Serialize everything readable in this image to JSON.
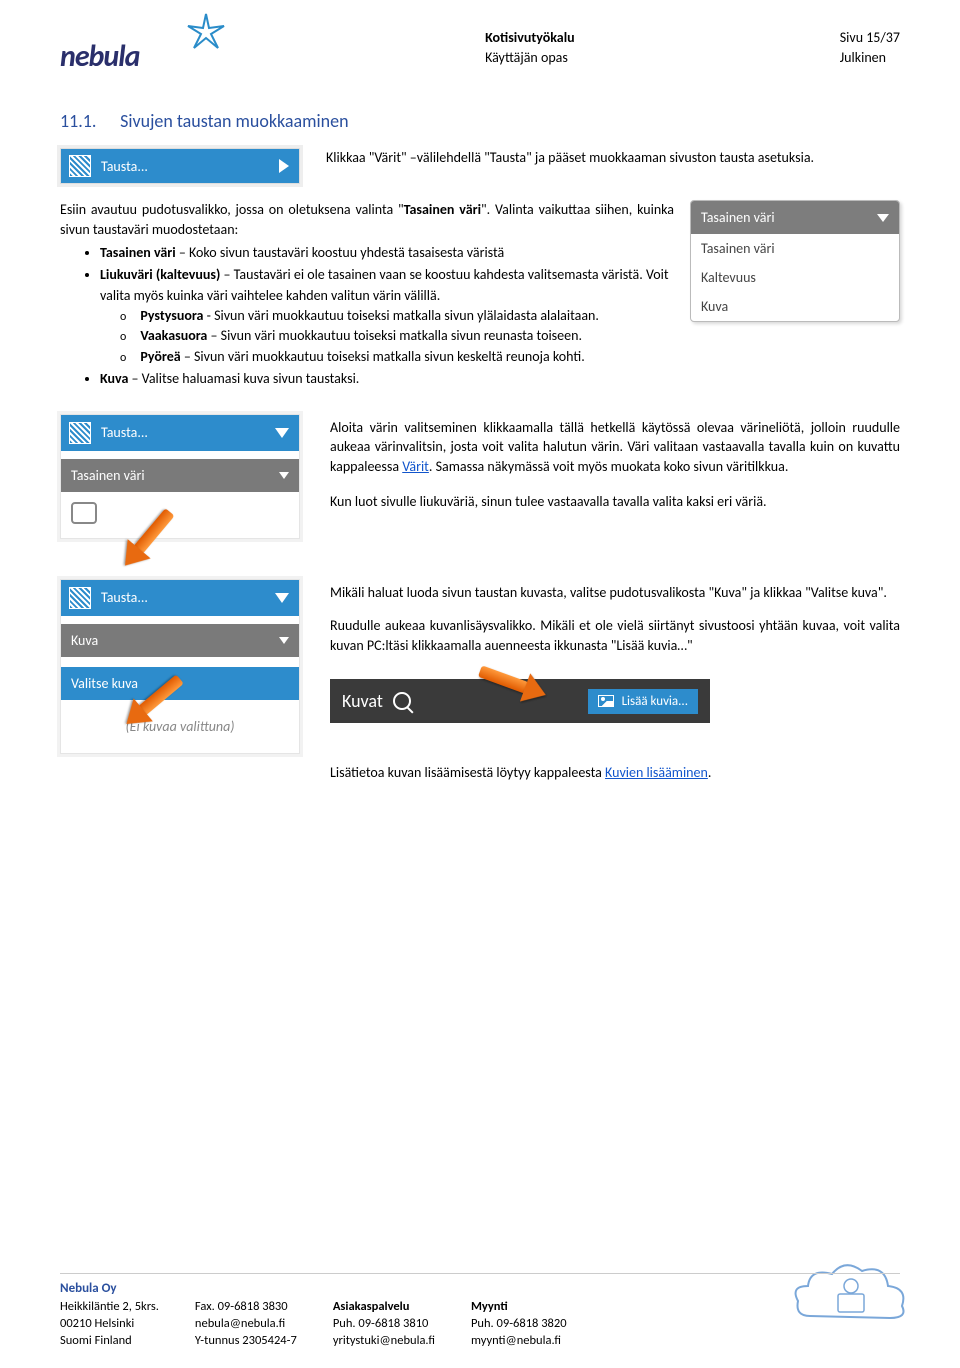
{
  "header": {
    "logo_text": "nebula",
    "doc_title": "Kotisivutyökalu",
    "doc_subtitle": "Käyttäjän opas",
    "page_info": "Sivu 15/37",
    "classification": "Julkinen"
  },
  "section": {
    "number": "11.1.",
    "title": "Sivujen taustan muokkaaminen"
  },
  "intro": "Klikkaa \"Värit\" –välilehdellä \"Tausta\" ja pääset muokkaaman sivuston tausta asetuksia.",
  "tausta_button_label": "Tausta...",
  "para_intro": {
    "pre": "Esiin avautuu pudotusvalikko, jossa on oletuksena valinta \"",
    "bold": "Tasainen väri",
    "post": "\". Valinta vaikuttaa siihen, kuinka sivun taustaväri muodostetaan:"
  },
  "dropdown": {
    "header": "Tasainen väri",
    "items": [
      "Tasainen väri",
      "Kaltevuus",
      "Kuva"
    ]
  },
  "bullets": {
    "b1_bold": "Tasainen väri",
    "b1_rest": " – Koko sivun taustaväri koostuu yhdestä tasaisesta väristä",
    "b2_bold": "Liukuväri (kaltevuus)",
    "b2_rest": " – Taustaväri ei ole tasainen vaan se koostuu kahdesta valitsemasta väristä. Voit valita myös kuinka väri vaihtelee kahden valitun värin välillä.",
    "s1_bold": "Pystysuora",
    "s1_rest": " - Sivun väri muokkautuu toiseksi matkalla sivun ylälaidasta alalaitaan.",
    "s2_bold": "Vaakasuora",
    "s2_rest": " – Sivun väri muokkautuu toiseksi matkalla sivun reunasta toiseen.",
    "s3_bold": "Pyöreä",
    "s3_rest": " – Sivun väri muokkautuu toiseksi matkalla sivun keskeltä reunoja kohti.",
    "b3_bold": "Kuva",
    "b3_rest": " – Valitse haluamasi kuva sivun taustaksi."
  },
  "panel2": {
    "tausta": "Tausta...",
    "row_label": "Tasainen väri"
  },
  "para2a_pre": "Aloita värin valitseminen klikkaamalla tällä hetkellä käytössä olevaa värineliötä, jolloin ruudulle aukeaa värinvalitsin, josta voit valita halutun värin. Väri valitaan vastaavalla tavalla kuin on kuvattu kappaleessa ",
  "para2a_link": "Värit",
  "para2a_post": ". Samassa näkymässä voit myös muokata koko sivun väritilkkua.",
  "para2b": "Kun luot sivulle liukuväriä, sinun tulee vastaavalla tavalla valita kaksi eri väriä.",
  "panel3": {
    "tausta": "Tausta...",
    "kuva": "Kuva",
    "valitse": "Valitse kuva",
    "empty": "(Ei kuvaa valittuna)"
  },
  "para3a": "Mikäli haluat luoda sivun taustan kuvasta, valitse pudotusvalikosta \"Kuva\" ja klikkaa \"Valitse kuva\".",
  "para3b": "Ruudulle aukeaa kuvanlisäysvalikko. Mikäli et ole vielä siirtänyt sivustoosi yhtään kuvaa, voit valita kuvan PC:ltäsi klikkaamalla auenneesta ikkunasta \"Lisää kuvia…\"",
  "kuvat_bar": {
    "title": "Kuvat",
    "add": "Lisää kuvia..."
  },
  "para4_pre": "Lisätietoa kuvan lisäämisestä löytyy kappaleesta ",
  "para4_link": "Kuvien lisääminen",
  "para4_post": ".",
  "footer": {
    "company": "Nebula Oy",
    "col1": [
      "Heikkiläntie 2, 5krs.",
      "00210 Helsinki",
      "Suomi Finland"
    ],
    "col2": [
      "Fax. 09-6818 3830",
      "nebula@nebula.fi",
      "Y-tunnus 2305424-7"
    ],
    "col3_h": "Asiakaspalvelu",
    "col3": [
      "Puh. 09-6818 3810",
      "yritystuki@nebula.fi"
    ],
    "col4_h": "Myynti",
    "col4": [
      "Puh. 09-6818 3820",
      "myynti@nebula.fi"
    ]
  }
}
